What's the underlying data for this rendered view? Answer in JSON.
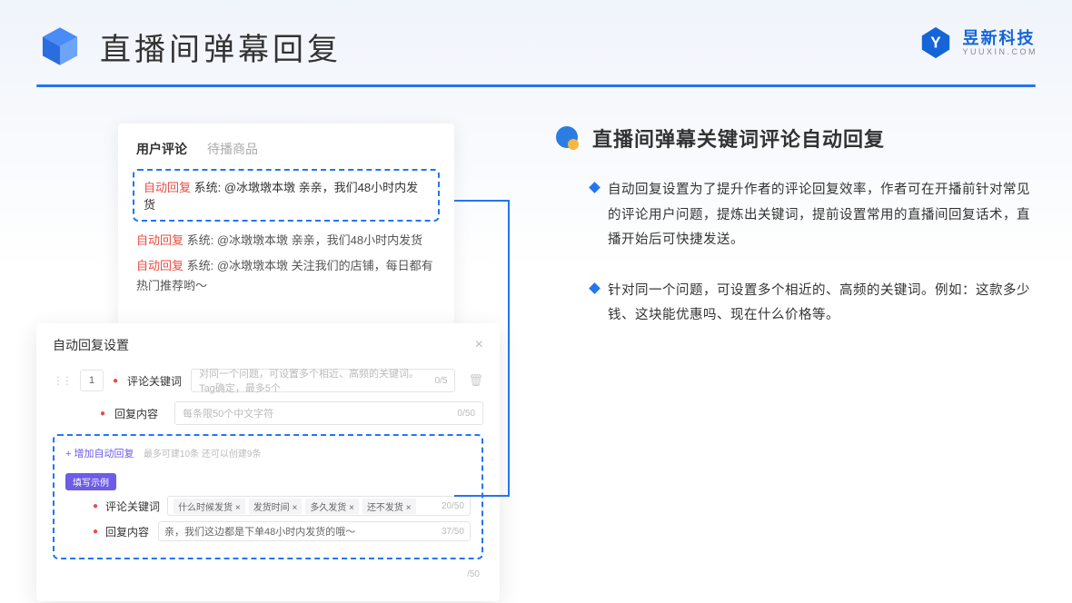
{
  "header": {
    "title": "直播间弹幕回复",
    "brand_cn": "昱新科技",
    "brand_en": "YUUXIN.COM"
  },
  "card1": {
    "tab_active": "用户评论",
    "tab_inactive": "待播商品",
    "hl_prefix": "自动回复",
    "hl_text": " 系统: @冰墩墩本墩 亲亲，我们48小时内发货",
    "msg2_prefix": "自动回复",
    "msg2_text": " 系统: @冰墩墩本墩 亲亲，我们48小时内发货",
    "msg3_prefix": "自动回复",
    "msg3_text": " 系统: @冰墩墩本墩 关注我们的店铺，每日都有热门推荐哟～"
  },
  "card2": {
    "title": "自动回复设置",
    "num": "1",
    "label_kw": "评论关键词",
    "ph_kw": "对同一个问题，可设置多个相近、高频的关键词。Tag确定，最多5个",
    "cnt_kw": "0/5",
    "label_content": "回复内容",
    "ph_content": "每条限50个中文字符",
    "cnt_content": "0/50",
    "add_link": "+ 增加自动回复",
    "add_hint": "最多可建10条 还可以创建9条",
    "pill": "填写示例",
    "ex_label_kw": "评论关键词",
    "ex_tags": [
      "什么时候发货 ×",
      "发货时间 ×",
      "多久发货 ×",
      "还不发货 ×"
    ],
    "ex_cnt_kw": "20/50",
    "ex_label_content": "回复内容",
    "ex_content": "亲，我们这边都是下单48小时内发货的哦～",
    "ex_cnt_content": "37/50",
    "bottom_cnt": "/50"
  },
  "right": {
    "title": "直播间弹幕关键词评论自动回复",
    "b1": "自动回复设置为了提升作者的评论回复效率，作者可在开播前针对常见的评论用户问题，提炼出关键词，提前设置常用的直播间回复话术，直播开始后可快捷发送。",
    "b2": "针对同一个问题，可设置多个相近的、高频的关键词。例如：这款多少钱、这块能优惠吗、现在什么价格等。"
  }
}
